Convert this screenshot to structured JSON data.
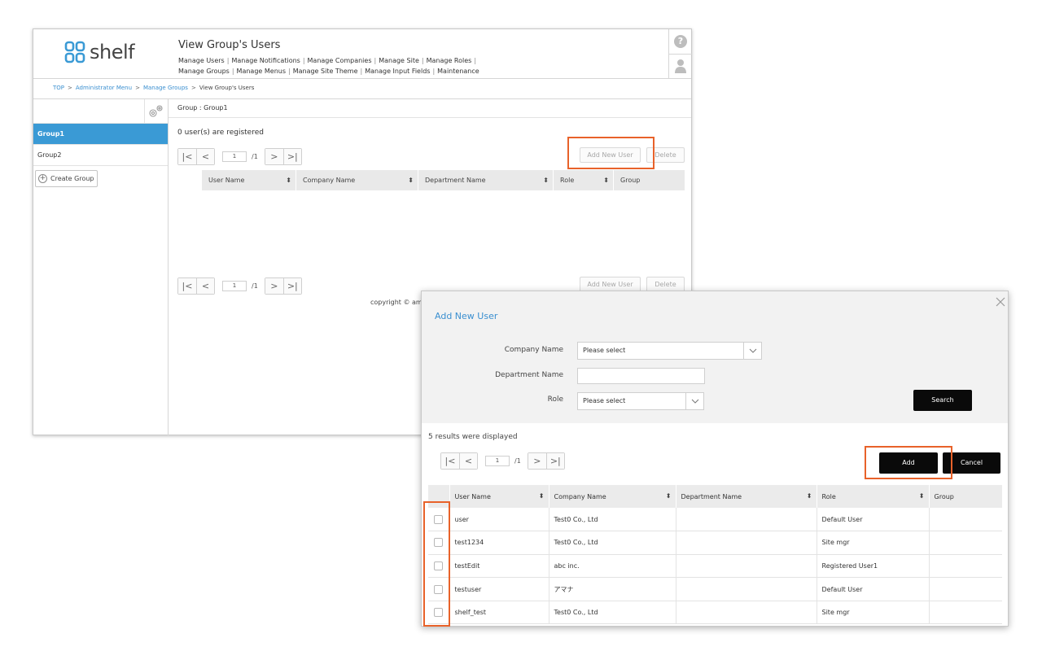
{
  "app": {
    "logo_text": "shelf",
    "page_title": "View Group's Users",
    "nav_row_1": [
      {
        "label": "Manage Users"
      },
      {
        "label": "Manage Notifications"
      },
      {
        "label": "Manage Companies"
      },
      {
        "label": "Manage Site"
      },
      {
        "label": "Manage Roles"
      }
    ],
    "nav_row_2": [
      {
        "label": "Manage Groups"
      },
      {
        "label": "Manage Menus"
      },
      {
        "label": "Manage Site Theme"
      },
      {
        "label": "Manage Input Fields"
      },
      {
        "label": "Maintenance"
      }
    ],
    "nav_separator": "|",
    "help_icon_glyph": "?"
  },
  "breadcrumb": {
    "items": [
      "TOP",
      "Administrator Menu",
      "Manage Groups"
    ],
    "current": "View Group's Users",
    "separator": ">"
  },
  "sidebar": {
    "groups": [
      {
        "label": "Group1",
        "active": true
      },
      {
        "label": "Group2",
        "active": false
      }
    ],
    "create_group_label": "Create Group",
    "create_group_icon_glyph": "+"
  },
  "main": {
    "group_label": "Group : Group1",
    "registered_text": "0 user(s) are registered",
    "pager": {
      "current_page": "1",
      "total": "/1"
    },
    "add_new_user_label": "Add New User",
    "delete_label": "Delete",
    "columns": [
      "User Name",
      "Company Name",
      "Department Name",
      "Role",
      "Group"
    ],
    "copyright": "copyright © amana"
  },
  "pager_icons": {
    "first": "|<",
    "prev": "<",
    "next": ">",
    "last": ">|"
  },
  "sort_icon_glyph": "⬍",
  "modal": {
    "title": "Add New User",
    "company_label": "Company Name",
    "company_value": "Please select",
    "department_label": "Department Name",
    "department_value": "",
    "role_label": "Role",
    "role_value": "Please select",
    "search_label": "Search",
    "results_text": "5 results were displayed",
    "pager": {
      "current_page": "1",
      "total": "/1"
    },
    "add_label": "Add",
    "cancel_label": "Cancel",
    "columns": [
      "User Name",
      "Company Name",
      "Department Name",
      "Role",
      "Group"
    ],
    "rows": [
      {
        "user_name": "user",
        "company": "Test0 Co., Ltd",
        "department": "",
        "role": "Default User",
        "group": ""
      },
      {
        "user_name": "test1234",
        "company": "Test0 Co., Ltd",
        "department": "",
        "role": "Site mgr",
        "group": ""
      },
      {
        "user_name": "testEdit",
        "company": "abc inc.",
        "department": "",
        "role": "Registered User1",
        "group": ""
      },
      {
        "user_name": "testuser",
        "company": "アマナ",
        "department": "",
        "role": "Default User",
        "group": ""
      },
      {
        "user_name": "shelf_test",
        "company": "Test0 Co., Ltd",
        "department": "",
        "role": "Site mgr",
        "group": ""
      }
    ]
  },
  "colors": {
    "accent_blue": "#3a9ad5",
    "link_blue": "#3a8fd0",
    "highlight_orange": "#e8622a",
    "button_black": "#0a0a0a"
  }
}
